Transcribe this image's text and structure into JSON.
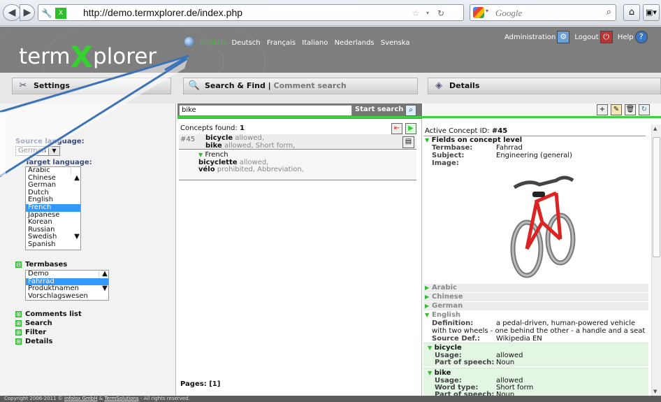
{
  "browser": {
    "url": "http://demo.termxplorer.de/index.php",
    "search_placeholder": "Google"
  },
  "header": {
    "logo_pre": "term",
    "logo_x": "X",
    "logo_post": "plorer",
    "languages": [
      "English",
      "Deutsch",
      "Français",
      "Italiano",
      "Nederlands",
      "Svenska"
    ],
    "active_language": "English",
    "admin": "Administration",
    "logout": "Logout",
    "help": "Help"
  },
  "columns": {
    "settings": "Settings",
    "search_find": "Search & Find",
    "separator": "|",
    "comment_search": "Comment search",
    "details": "Details"
  },
  "left": {
    "source_label": "Source language:",
    "source_value": "German",
    "target_label": "Target language:",
    "target_options": [
      "Arabic",
      "Chinese",
      "German",
      "Dutch",
      "English",
      "French",
      "Japanese",
      "Korean",
      "Russian",
      "Swedish",
      "Spanish"
    ],
    "target_selected": "French",
    "termbases_label": "Termbases",
    "termbases": [
      "Demo",
      "Fahrrad",
      "Produktnamen",
      "Vorschlagswesen"
    ],
    "termbase_selected": "Fahrrad",
    "links": [
      "Comments list",
      "Search",
      "Filter",
      "Details"
    ]
  },
  "middle": {
    "search_value": "bike",
    "start_search": "Start search",
    "concepts_found_label": "Concepts found:",
    "concepts_found": "1",
    "result": {
      "id": "#45",
      "term1": "bicycle",
      "term1_attr": "allowed,",
      "term2": "bike",
      "term2_attr": "allowed, Short form,",
      "lang": "French",
      "term3": "bicyclette",
      "term3_attr": "allowed,",
      "term4": "vélo",
      "term4_attr": "prohibited, Abbreviation,"
    },
    "pages_label": "Pages:",
    "pages": "[1]"
  },
  "right": {
    "active_label": "Active Concept ID:",
    "active_id": "#45",
    "concept_level": "Fields on concept level",
    "termbase_k": "Termbase:",
    "termbase_v": "Fahrrad",
    "subject_k": "Subject:",
    "subject_v": "Engineering (general)",
    "image_k": "Image:",
    "sections": [
      "Arabic",
      "Chinese",
      "German",
      "English"
    ],
    "definition_k": "Definition:",
    "definition_v1": "a pedal-driven, human-powered vehicle",
    "definition_v2": "with two wheels - one behind the other - a handle and a seat",
    "sourcedef_k": "Source Def.:",
    "sourcedef_v": "Wikipedia EN",
    "t1": "bicycle",
    "usage_k": "Usage:",
    "usage_v": "allowed",
    "pos_k": "Part of speech:",
    "pos_v": "Noun",
    "t2": "bike",
    "wordtype_k": "Word type:",
    "wordtype_v": "Short form"
  },
  "footer": {
    "pre": "Copyright 2006-2011 ©",
    "infolox": "infolox GmbH",
    "amp": "&",
    "termsolutions": "TermSolutions",
    "post": "- All rights reserved."
  },
  "colors": {
    "green": "#3dd33d",
    "header_gray": "#7e7e7e",
    "selected_blue": "#3399ff",
    "callout_blue": "#3b72b8"
  }
}
